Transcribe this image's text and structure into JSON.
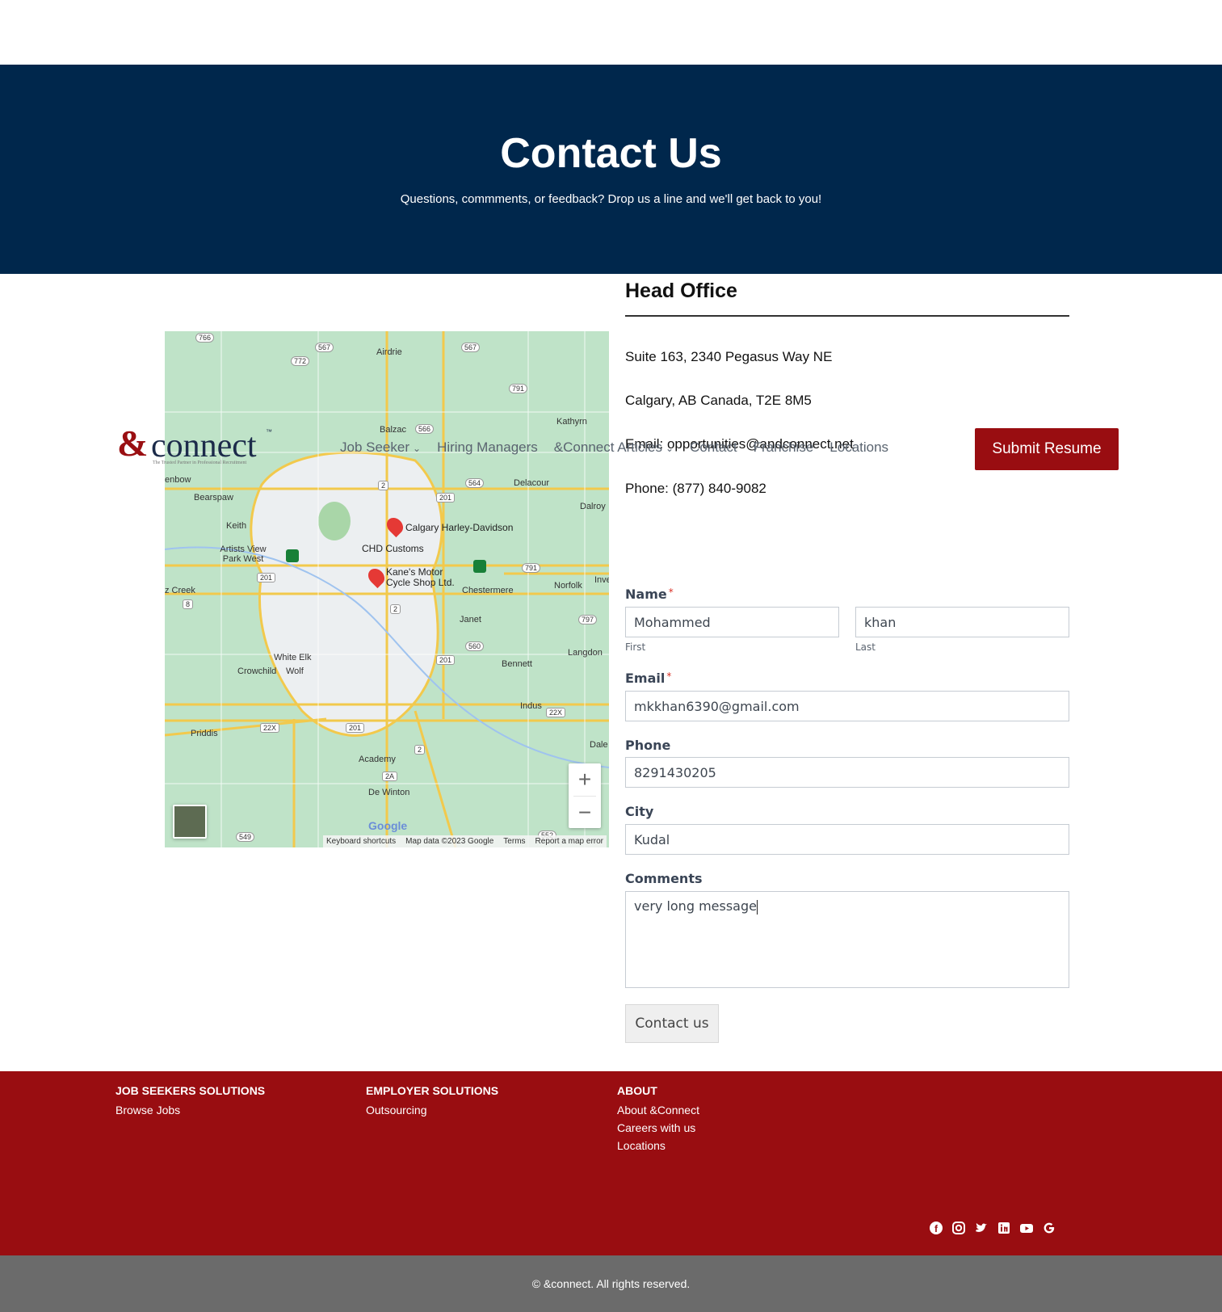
{
  "hero": {
    "title": "Contact Us",
    "subtitle": "Questions, commments, or feedback? Drop us a line and we'll get back to you!"
  },
  "nav": {
    "logo": {
      "amp": "&",
      "word": "connect",
      "tm": "™",
      "tagline": "The Trusted Partner in Professional Recruitment"
    },
    "items": [
      {
        "label": "Job Seeker",
        "dropdown": true
      },
      {
        "label": "Hiring Managers",
        "dropdown": false
      },
      {
        "label": "&Connect Articles",
        "dropdown": true
      },
      {
        "label": "Contact",
        "dropdown": false
      },
      {
        "label": "Franchise",
        "dropdown": false
      },
      {
        "label": "Locations",
        "dropdown": false
      }
    ],
    "cta": "Submit Resume"
  },
  "office": {
    "title": "Head Office",
    "address1": "Suite 163, 2340 Pegasus Way NE",
    "address2": "Calgary, AB Canada, T2E 8M5",
    "email": "Email: opportunities@andconnect.net",
    "phone": "Phone: (877) 840-9082"
  },
  "map": {
    "places": [
      "Airdrie",
      "Balzac",
      "Kathyrn",
      "Delacour",
      "Dalroy",
      "Bearspaw",
      "Keith",
      "Artists View Park West",
      "Chestermere",
      "Norfolk",
      "Janet",
      "Langdon",
      "Bennett",
      "White Elk",
      "Crowchild",
      "Wolf",
      "Indus",
      "Priddis",
      "Academy",
      "De Winton",
      "Dale",
      "Inve",
      "z Creek",
      "enbow"
    ],
    "pois": [
      "Calgary Harley-Davidson",
      "CHD Customs",
      "Kane's Motor Cycle Shop Ltd."
    ],
    "shields": [
      "766",
      "567",
      "772",
      "567",
      "791",
      "566",
      "2",
      "564",
      "201",
      "201",
      "791",
      "8",
      "2",
      "797",
      "560",
      "201",
      "22X",
      "22X",
      "201",
      "2",
      "2A",
      "549",
      "552"
    ],
    "google": "Google",
    "footer": [
      "Keyboard shortcuts",
      "Map data ©2023 Google",
      "Terms",
      "Report a map error"
    ],
    "zoom_in": "+",
    "zoom_out": "−"
  },
  "form": {
    "name_label": "Name",
    "first_value": "Mohammed",
    "last_value": "khan",
    "first_sub": "First",
    "last_sub": "Last",
    "email_label": "Email",
    "email_value": "mkkhan6390@gmail.com",
    "phone_label": "Phone",
    "phone_value": "8291430205",
    "city_label": "City",
    "city_value": "Kudal",
    "comments_label": "Comments",
    "comments_value": "very long message",
    "required_mark": "*",
    "submit": "Contact us"
  },
  "footer": {
    "columns": [
      {
        "heading": "JOB SEEKERS SOLUTIONS",
        "links": [
          "Browse Jobs"
        ]
      },
      {
        "heading": "EMPLOYER SOLUTIONS",
        "links": [
          "Outsourcing"
        ]
      },
      {
        "heading": "ABOUT",
        "links": [
          "About &Connect",
          "Careers with us",
          "Locations"
        ]
      }
    ],
    "social": [
      "facebook-icon",
      "instagram-icon",
      "twitter-icon",
      "linkedin-icon",
      "youtube-icon",
      "google-icon"
    ],
    "copyright": "© &connect. All rights reserved."
  },
  "colors": {
    "navy": "#00274c",
    "brand_red": "#990d11",
    "gray_bar": "#6b6b6b"
  }
}
